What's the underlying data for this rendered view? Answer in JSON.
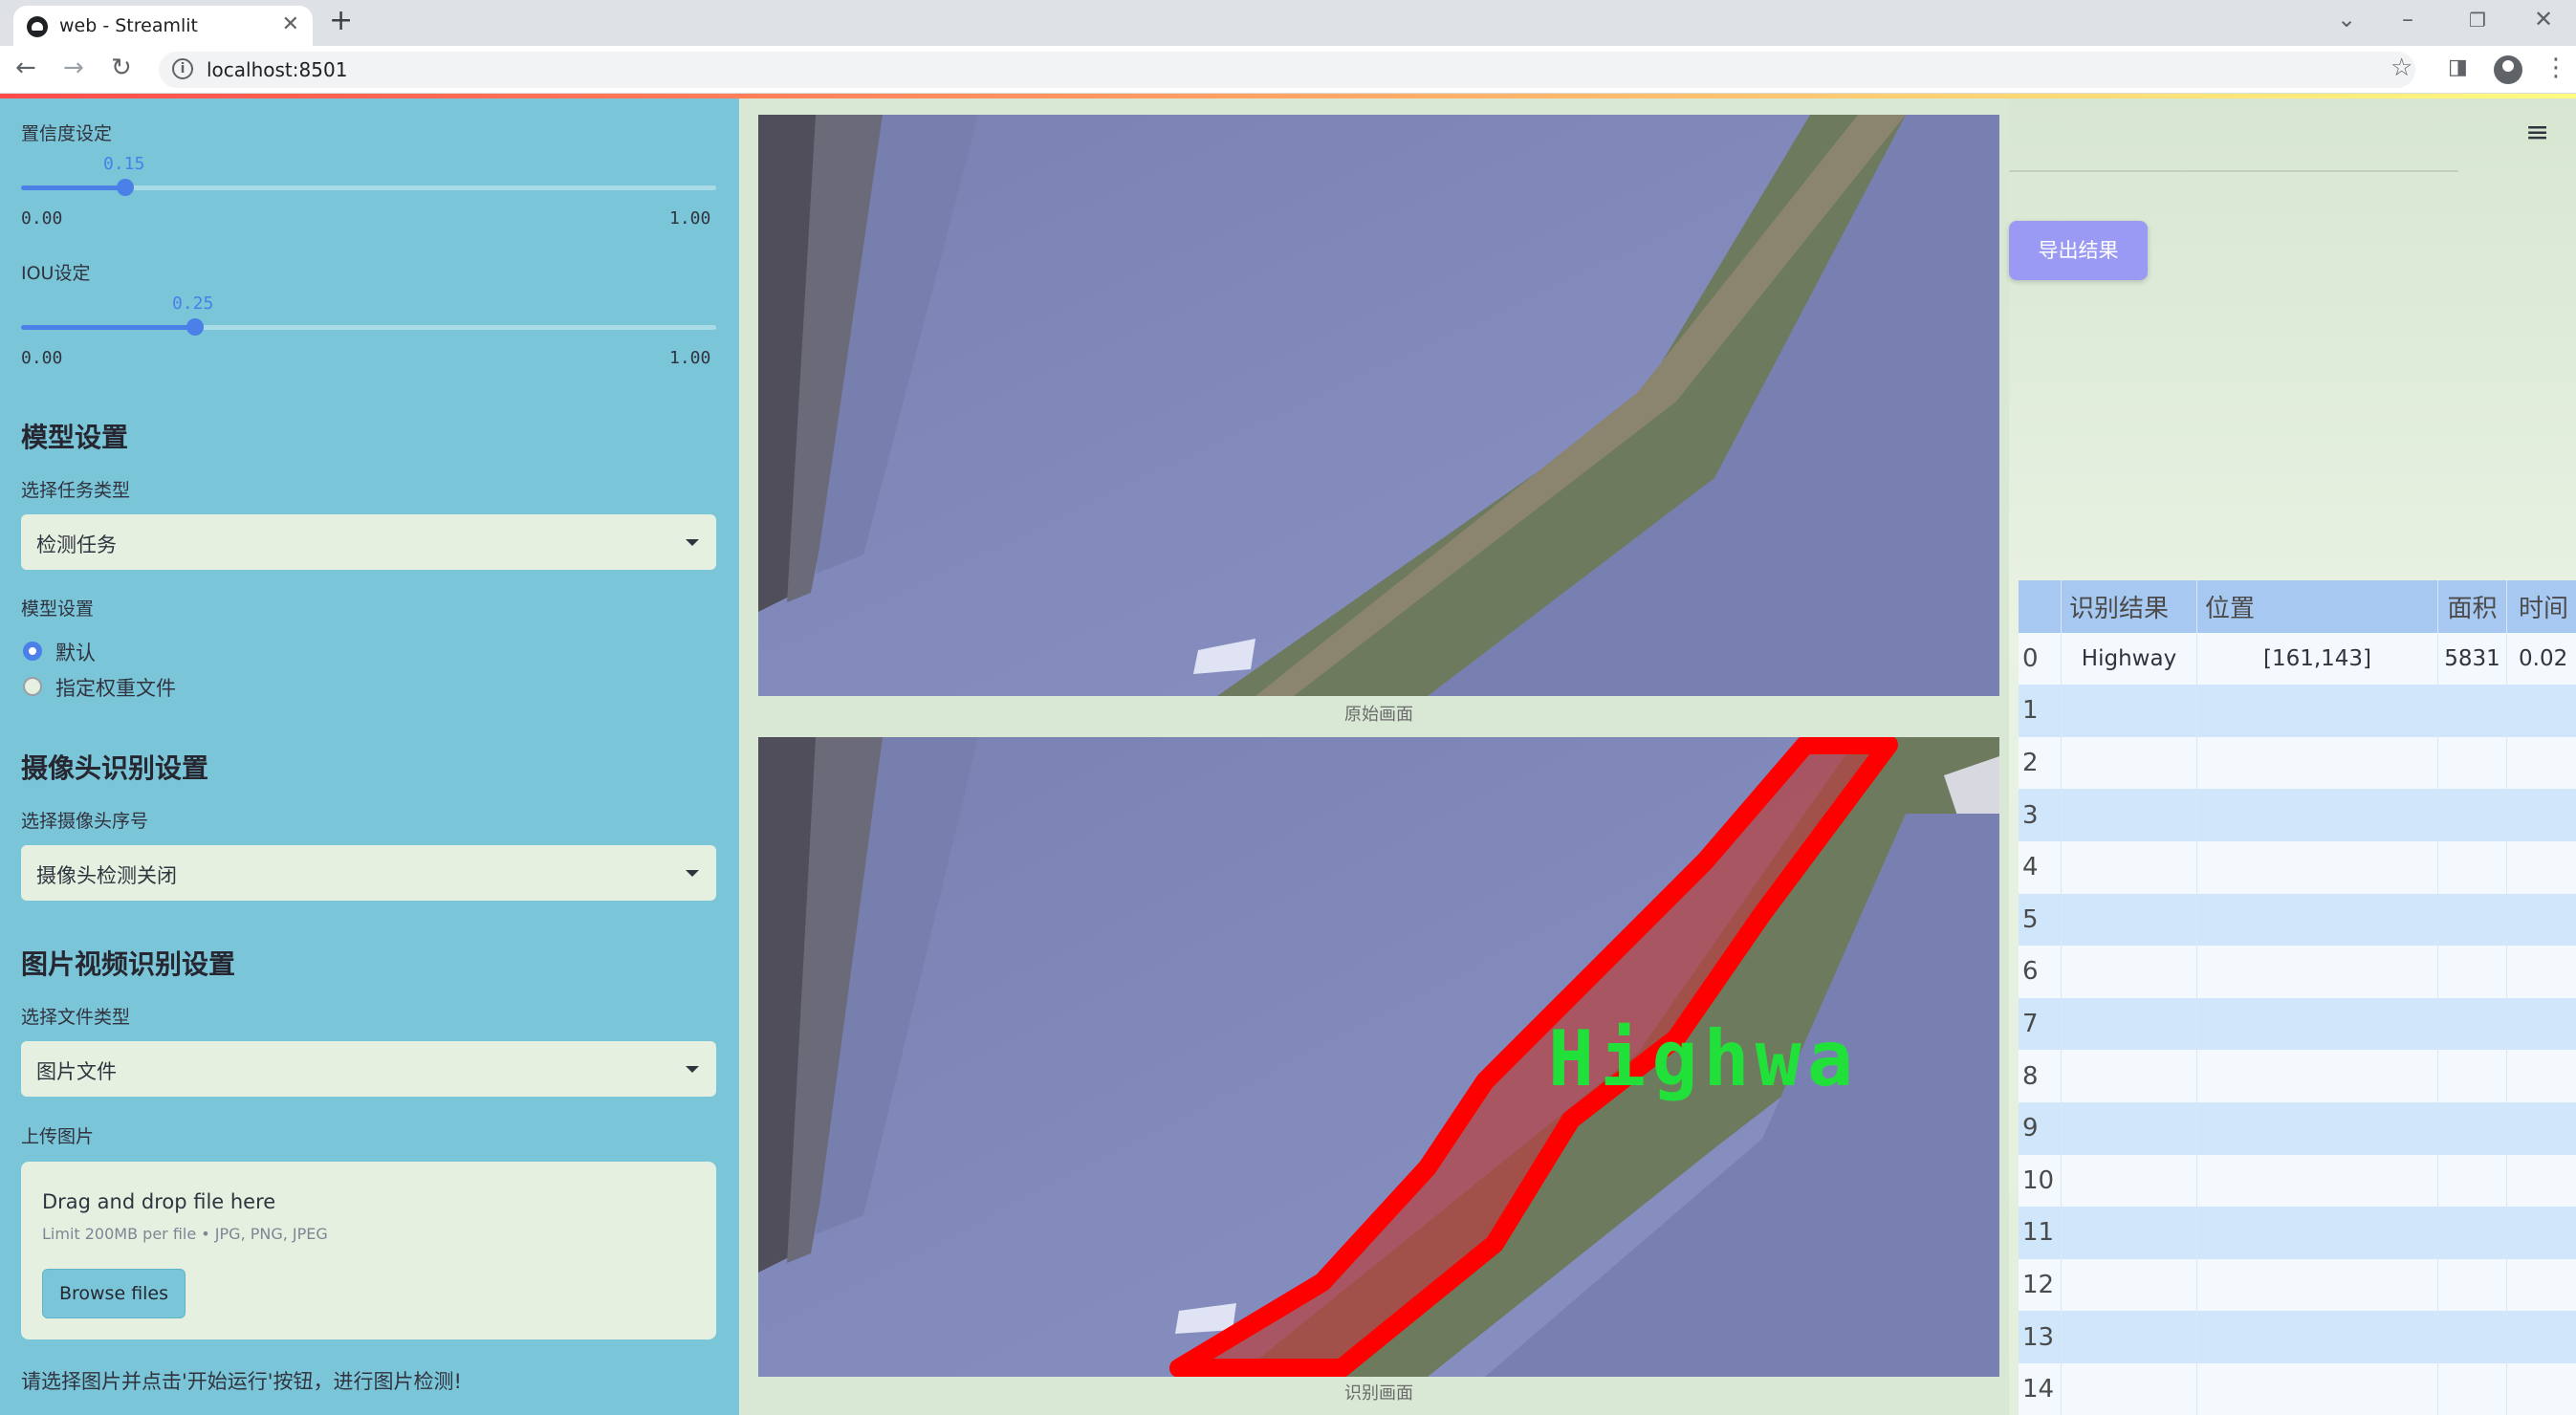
{
  "browser": {
    "tab_title": "web - Streamlit",
    "url": "localhost:8501"
  },
  "sidebar": {
    "confidence": {
      "label": "置信度设定",
      "value": "0.15",
      "value_num": 0.15,
      "min": "0.00",
      "max": "1.00"
    },
    "iou": {
      "label": "IOU设定",
      "value": "0.25",
      "value_num": 0.25,
      "min": "0.00",
      "max": "1.00"
    },
    "model_section": {
      "heading": "模型设置",
      "task_label": "选择任务类型",
      "task_value": "检测任务",
      "model_label": "模型设置",
      "options": [
        "默认",
        "指定权重文件"
      ],
      "selected_option": "默认"
    },
    "camera_section": {
      "heading": "摄像头识别设置",
      "camera_label": "选择摄像头序号",
      "camera_value": "摄像头检测关闭"
    },
    "media_section": {
      "heading": "图片视频识别设置",
      "file_type_label": "选择文件类型",
      "file_type_value": "图片文件",
      "upload_label": "上传图片",
      "upload_title": "Drag and drop file here",
      "upload_limit": "Limit 200MB per file • JPG, PNG, JPEG",
      "browse_label": "Browse files"
    },
    "hint": "请选择图片并点击'开始运行'按钮，进行图片检测!"
  },
  "main": {
    "original_caption": "原始画面",
    "result_caption": "识别画面",
    "detection_label": "Highwa",
    "export_label": "导出结果"
  },
  "table": {
    "headers": [
      "识别结果",
      "位置",
      "面积",
      "时间"
    ],
    "rows": [
      {
        "index": "0",
        "result": "Highway",
        "position": "[161,143]",
        "area": "5831",
        "time": "0.02"
      },
      {
        "index": "1"
      },
      {
        "index": "2"
      },
      {
        "index": "3"
      },
      {
        "index": "4"
      },
      {
        "index": "5"
      },
      {
        "index": "6"
      },
      {
        "index": "7"
      },
      {
        "index": "8"
      },
      {
        "index": "9"
      },
      {
        "index": "10"
      },
      {
        "index": "11"
      },
      {
        "index": "12"
      },
      {
        "index": "13"
      },
      {
        "index": "14"
      }
    ]
  },
  "colors": {
    "sidebar_bg": "#7ac5d8",
    "main_bg": "#d9e8d4",
    "accent": "#4a80e8",
    "export_button": "#9a9af4",
    "detection_box": "#ff0000",
    "detection_text": "#22e03a",
    "table_header": "#a7c8f0",
    "table_row_alt": "#cfe6fb"
  }
}
